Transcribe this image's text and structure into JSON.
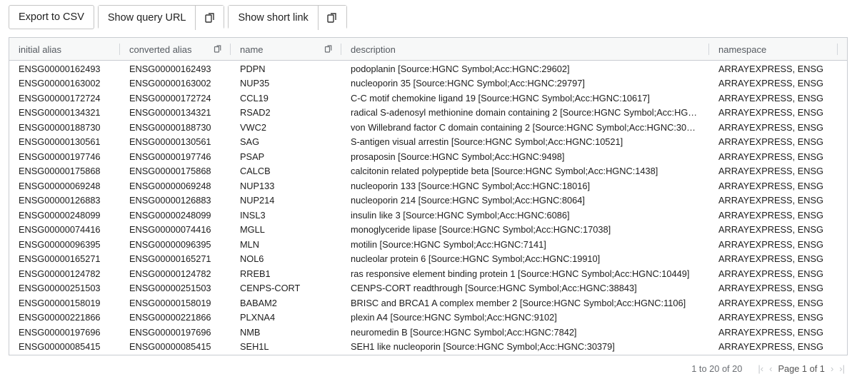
{
  "toolbar": {
    "export_label": "Export to CSV",
    "query_url_label": "Show query URL",
    "short_link_label": "Show short link"
  },
  "columns": [
    "initial alias",
    "converted alias",
    "name",
    "description",
    "namespace"
  ],
  "rows": [
    [
      "ENSG00000162493",
      "ENSG00000162493",
      "PDPN",
      "podoplanin [Source:HGNC Symbol;Acc:HGNC:29602]",
      "ARRAYEXPRESS, ENSG"
    ],
    [
      "ENSG00000163002",
      "ENSG00000163002",
      "NUP35",
      "nucleoporin 35 [Source:HGNC Symbol;Acc:HGNC:29797]",
      "ARRAYEXPRESS, ENSG"
    ],
    [
      "ENSG00000172724",
      "ENSG00000172724",
      "CCL19",
      "C-C motif chemokine ligand 19 [Source:HGNC Symbol;Acc:HGNC:10617]",
      "ARRAYEXPRESS, ENSG"
    ],
    [
      "ENSG00000134321",
      "ENSG00000134321",
      "RSAD2",
      "radical S-adenosyl methionine domain containing 2 [Source:HGNC Symbol;Acc:HG…",
      "ARRAYEXPRESS, ENSG"
    ],
    [
      "ENSG00000188730",
      "ENSG00000188730",
      "VWC2",
      "von Willebrand factor C domain containing 2 [Source:HGNC Symbol;Acc:HGNC:30…",
      "ARRAYEXPRESS, ENSG"
    ],
    [
      "ENSG00000130561",
      "ENSG00000130561",
      "SAG",
      "S-antigen visual arrestin [Source:HGNC Symbol;Acc:HGNC:10521]",
      "ARRAYEXPRESS, ENSG"
    ],
    [
      "ENSG00000197746",
      "ENSG00000197746",
      "PSAP",
      "prosaposin [Source:HGNC Symbol;Acc:HGNC:9498]",
      "ARRAYEXPRESS, ENSG"
    ],
    [
      "ENSG00000175868",
      "ENSG00000175868",
      "CALCB",
      "calcitonin related polypeptide beta [Source:HGNC Symbol;Acc:HGNC:1438]",
      "ARRAYEXPRESS, ENSG"
    ],
    [
      "ENSG00000069248",
      "ENSG00000069248",
      "NUP133",
      "nucleoporin 133 [Source:HGNC Symbol;Acc:HGNC:18016]",
      "ARRAYEXPRESS, ENSG"
    ],
    [
      "ENSG00000126883",
      "ENSG00000126883",
      "NUP214",
      "nucleoporin 214 [Source:HGNC Symbol;Acc:HGNC:8064]",
      "ARRAYEXPRESS, ENSG"
    ],
    [
      "ENSG00000248099",
      "ENSG00000248099",
      "INSL3",
      "insulin like 3 [Source:HGNC Symbol;Acc:HGNC:6086]",
      "ARRAYEXPRESS, ENSG"
    ],
    [
      "ENSG00000074416",
      "ENSG00000074416",
      "MGLL",
      "monoglyceride lipase [Source:HGNC Symbol;Acc:HGNC:17038]",
      "ARRAYEXPRESS, ENSG"
    ],
    [
      "ENSG00000096395",
      "ENSG00000096395",
      "MLN",
      "motilin [Source:HGNC Symbol;Acc:HGNC:7141]",
      "ARRAYEXPRESS, ENSG"
    ],
    [
      "ENSG00000165271",
      "ENSG00000165271",
      "NOL6",
      "nucleolar protein 6 [Source:HGNC Symbol;Acc:HGNC:19910]",
      "ARRAYEXPRESS, ENSG"
    ],
    [
      "ENSG00000124782",
      "ENSG00000124782",
      "RREB1",
      "ras responsive element binding protein 1 [Source:HGNC Symbol;Acc:HGNC:10449]",
      "ARRAYEXPRESS, ENSG"
    ],
    [
      "ENSG00000251503",
      "ENSG00000251503",
      "CENPS-CORT",
      "CENPS-CORT readthrough [Source:HGNC Symbol;Acc:HGNC:38843]",
      "ARRAYEXPRESS, ENSG"
    ],
    [
      "ENSG00000158019",
      "ENSG00000158019",
      "BABAM2",
      "BRISC and BRCA1 A complex member 2 [Source:HGNC Symbol;Acc:HGNC:1106]",
      "ARRAYEXPRESS, ENSG"
    ],
    [
      "ENSG00000221866",
      "ENSG00000221866",
      "PLXNA4",
      "plexin A4 [Source:HGNC Symbol;Acc:HGNC:9102]",
      "ARRAYEXPRESS, ENSG"
    ],
    [
      "ENSG00000197696",
      "ENSG00000197696",
      "NMB",
      "neuromedin B [Source:HGNC Symbol;Acc:HGNC:7842]",
      "ARRAYEXPRESS, ENSG"
    ],
    [
      "ENSG00000085415",
      "ENSG00000085415",
      "SEH1L",
      "SEH1 like nucleoporin [Source:HGNC Symbol;Acc:HGNC:30379]",
      "ARRAYEXPRESS, ENSG"
    ]
  ],
  "footer": {
    "summary": "1 to 20 of 20",
    "page_label": "Page 1 of 1"
  },
  "icons": {
    "copy": "copy-to-clipboard-icon",
    "first": "first-page-icon",
    "prev": "previous-page-icon",
    "next": "next-page-icon",
    "last": "last-page-icon"
  }
}
